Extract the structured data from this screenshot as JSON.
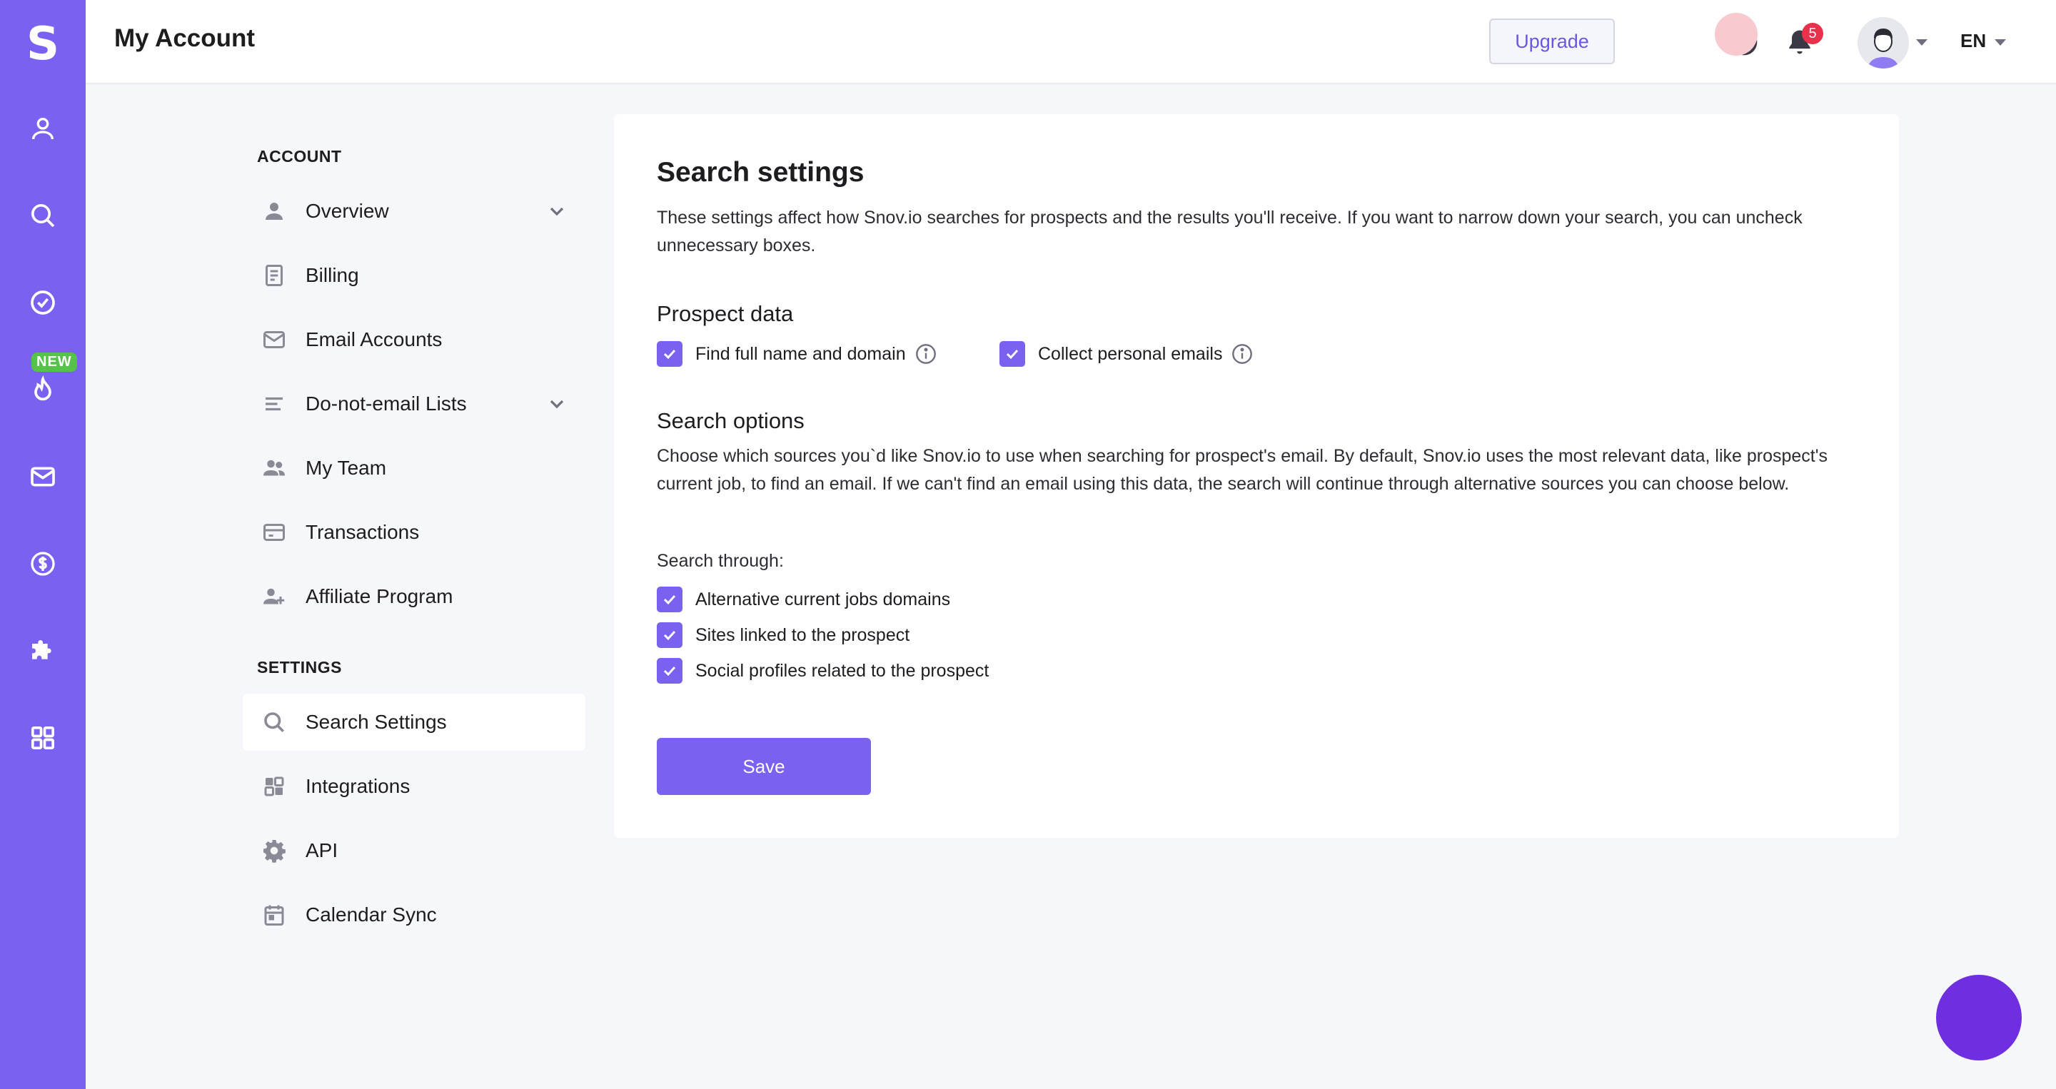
{
  "app": {
    "logo": "S",
    "rail_badge": "NEW",
    "rail_items": [
      {
        "icon": "user-icon"
      },
      {
        "icon": "search-icon"
      },
      {
        "icon": "check-circle-icon"
      },
      {
        "icon": "flame-icon"
      },
      {
        "icon": "mail-icon"
      },
      {
        "icon": "dollar-icon"
      },
      {
        "icon": "puzzle-icon"
      },
      {
        "icon": "apps-grid-icon"
      }
    ]
  },
  "header": {
    "title": "My Account",
    "upgrade_label": "Upgrade",
    "notification_count": "5",
    "language": "EN"
  },
  "side_menu": {
    "account_label": "ACCOUNT",
    "settings_label": "SETTINGS",
    "account_items": [
      {
        "label": "Overview",
        "icon": "person-icon",
        "expandable": true
      },
      {
        "label": "Billing",
        "icon": "document-icon"
      },
      {
        "label": "Email Accounts",
        "icon": "envelope-icon"
      },
      {
        "label": "Do-not-email Lists",
        "icon": "list-icon",
        "expandable": true
      },
      {
        "label": "My Team",
        "icon": "team-icon"
      },
      {
        "label": "Transactions",
        "icon": "card-icon"
      },
      {
        "label": "Affiliate Program",
        "icon": "user-plus-icon"
      }
    ],
    "settings_items": [
      {
        "label": "Search Settings",
        "icon": "search-icon",
        "active": true
      },
      {
        "label": "Integrations",
        "icon": "grid-icon"
      },
      {
        "label": "API",
        "icon": "gear-icon"
      },
      {
        "label": "Calendar Sync",
        "icon": "calendar-icon"
      }
    ]
  },
  "main": {
    "title": "Search settings",
    "description": "These settings affect how Snov.io searches for prospects and the results you'll receive. If you want to narrow down your search, you can uncheck unnecessary boxes.",
    "prospect_data": {
      "heading": "Prospect data",
      "options": [
        {
          "label": "Find full name and domain",
          "checked": true
        },
        {
          "label": "Collect personal emails",
          "checked": true
        }
      ]
    },
    "search_options": {
      "heading": "Search options",
      "description": "Choose which sources you`d like Snov.io to use when searching for prospect's email. By default, Snov.io uses the most relevant data, like prospect's current job, to find an email. If we can't find an email using this data, the search will continue through alternative sources you can choose below.",
      "search_through_label": "Search through:",
      "options": [
        {
          "label": "Alternative current jobs domains",
          "checked": true
        },
        {
          "label": "Sites linked to the prospect",
          "checked": true
        },
        {
          "label": "Social profiles related to the prospect",
          "checked": true
        }
      ]
    },
    "save_label": "Save"
  },
  "colors": {
    "accent": "#7b61f0",
    "chat_bubble": "#6f2ee0",
    "new_badge": "#55c34a",
    "notification": "#e8314a"
  }
}
